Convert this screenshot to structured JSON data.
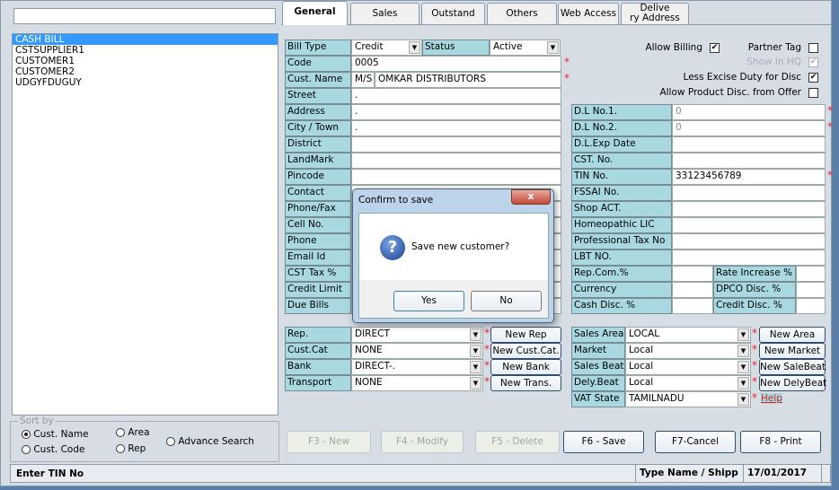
{
  "search": {
    "value": ""
  },
  "customers": [
    "CASH BILL",
    "CSTSUPPLIER1",
    "CUSTOMER1",
    "CUSTOMER2",
    "UDGYFDUGUY"
  ],
  "sort": {
    "title": "Sort by",
    "options": [
      "Cust. Name",
      "Cust. Code",
      "Area",
      "Rep",
      "Advance Search"
    ],
    "selected": "Cust. Name"
  },
  "tabs": [
    "General",
    "Sales",
    "Outstand",
    "Others",
    "Web Access",
    "Delive\nry Address"
  ],
  "general": {
    "bill_type_label": "Bill Type",
    "bill_type": "Credit",
    "status_label": "Status",
    "status": "Active",
    "left_rows": [
      {
        "label": "Code",
        "value": "0005",
        "required": true
      },
      {
        "label": "Cust. Name",
        "prefix": "M/S",
        "value": "OMKAR DISTRIBUTORS",
        "required": true
      },
      {
        "label": "Street",
        "value": "."
      },
      {
        "label": "Address",
        "value": "."
      },
      {
        "label": "City / Town",
        "value": "."
      },
      {
        "label": "District",
        "value": ""
      },
      {
        "label": "LandMark",
        "value": ""
      },
      {
        "label": "Pincode",
        "value": ""
      },
      {
        "label": "Contact",
        "value": ""
      },
      {
        "label": "Phone/Fax",
        "value": ""
      },
      {
        "label": "Cell No.",
        "value": ""
      },
      {
        "label": "Phone",
        "value": ""
      },
      {
        "label": "Email Id",
        "value": ""
      },
      {
        "label": "CST Tax %",
        "value": ""
      },
      {
        "label": "Credit Limit",
        "value": ""
      },
      {
        "label": "Due Bills",
        "value": ""
      }
    ],
    "checks": [
      {
        "label": "Allow Billing",
        "checked": true
      },
      {
        "label": "Partner Tag",
        "checked": false
      },
      {
        "label": "Show in HQ",
        "checked": true,
        "disabled": true
      },
      {
        "label": "Less Excise Duty for Disc",
        "checked": true
      },
      {
        "label": "Allow Product Disc. from Offer",
        "checked": false
      }
    ],
    "right_rows": [
      {
        "label": "D.L No.1.",
        "value": "0",
        "required": true
      },
      {
        "label": "D.L No.2.",
        "value": "0",
        "required": true
      },
      {
        "label": "D.L.Exp Date",
        "value": ""
      },
      {
        "label": "CST. No.",
        "value": ""
      },
      {
        "label": "TIN No.",
        "value": "33123456789",
        "required": true
      },
      {
        "label": "FSSAI No.",
        "value": ""
      },
      {
        "label": "Shop ACT.",
        "value": ""
      },
      {
        "label": "Homeopathic LIC",
        "value": ""
      },
      {
        "label": "Professional Tax No",
        "value": ""
      },
      {
        "label": "LBT NO.",
        "value": ""
      }
    ],
    "split_rows": [
      {
        "label": "Rep.Com.%",
        "value": "",
        "label2": "Rate Increase %",
        "value2": ""
      },
      {
        "label": "Currency",
        "value": "",
        "label2": "DPCO Disc. %",
        "value2": ""
      },
      {
        "label": "Cash Disc. %",
        "value": "",
        "label2": "Credit Disc. %",
        "value2": ""
      }
    ],
    "combos_left": [
      {
        "label": "Rep.",
        "value": "DIRECT",
        "button": "New Rep"
      },
      {
        "label": "Cust.Cat",
        "value": "NONE",
        "button": "New Cust.Cat."
      },
      {
        "label": "Bank",
        "value": "DIRECT-.",
        "button": "New Bank"
      },
      {
        "label": "Transport",
        "value": "NONE",
        "button": "New Trans."
      }
    ],
    "combos_right": [
      {
        "label": "Sales Area",
        "value": "LOCAL",
        "button": "New Area"
      },
      {
        "label": "Market",
        "value": "Local",
        "button": "New Market"
      },
      {
        "label": "Sales Beat",
        "value": "Local",
        "button": "New SaleBeat"
      },
      {
        "label": "Dely.Beat",
        "value": "Local",
        "button": "New DelyBeat"
      },
      {
        "label": "VAT State",
        "value": "TAMILNADU",
        "link": "Help"
      }
    ]
  },
  "actions": [
    {
      "label": "F3 - New",
      "enabled": false
    },
    {
      "label": "F4 - Modify",
      "enabled": false
    },
    {
      "label": "F5 - Delete",
      "enabled": false
    },
    {
      "label": "F6 - Save",
      "enabled": true
    },
    {
      "label": "F7-Cancel",
      "enabled": true
    },
    {
      "label": "F8 - Print",
      "enabled": true
    }
  ],
  "status": {
    "hint": "Enter TIN No",
    "mode": "Type Name / Shipp",
    "date": "17/01/2017"
  },
  "dialog": {
    "title": "Confirm to save",
    "message": "Save new customer?",
    "yes": "Yes",
    "no": "No",
    "close": "x"
  }
}
